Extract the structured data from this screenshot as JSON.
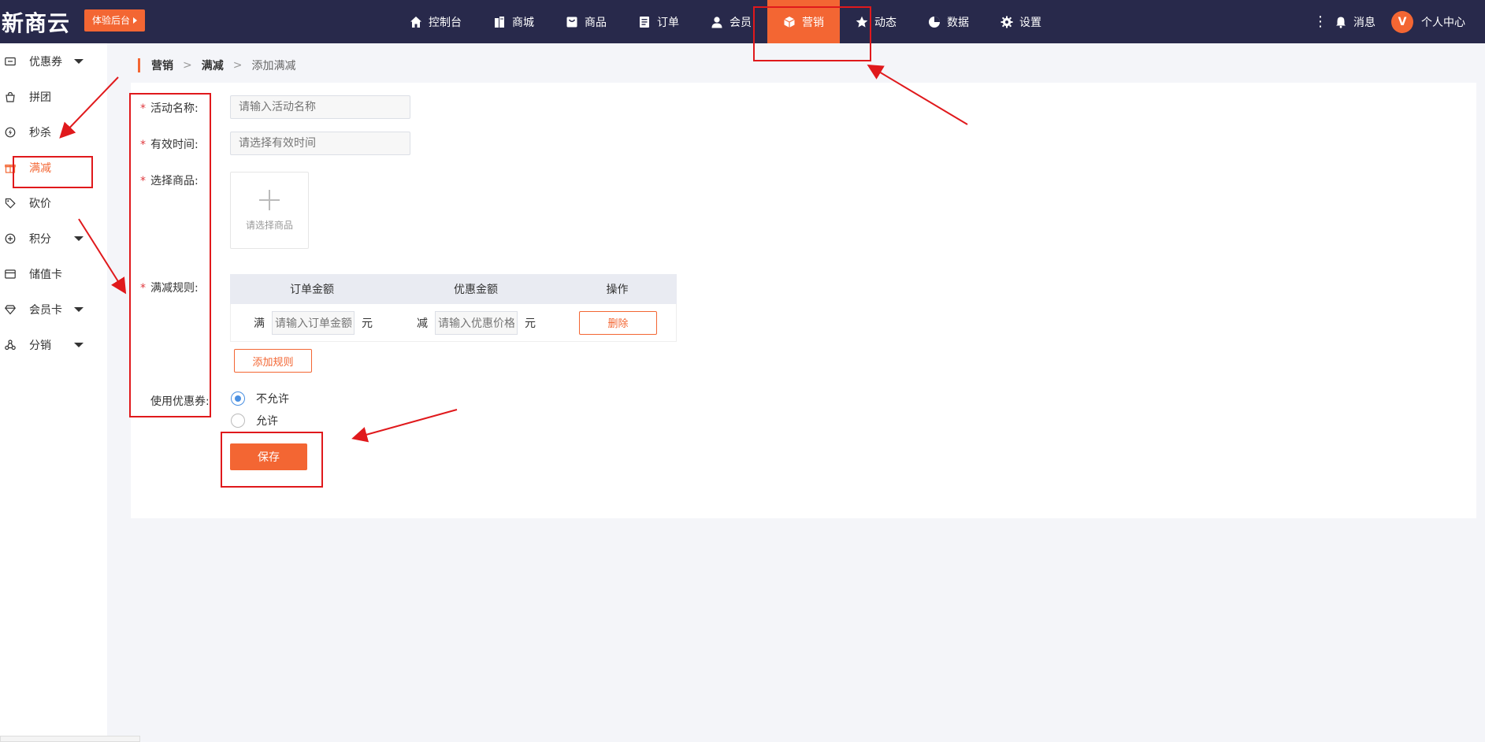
{
  "header": {
    "logo": "新商云",
    "trial_button": "体验后台",
    "nav": [
      {
        "label": "控制台",
        "icon": "home-icon"
      },
      {
        "label": "商城",
        "icon": "store-icon"
      },
      {
        "label": "商品",
        "icon": "goods-icon"
      },
      {
        "label": "订单",
        "icon": "order-icon"
      },
      {
        "label": "会员",
        "icon": "member-icon"
      },
      {
        "label": "营销",
        "icon": "marketing-icon",
        "active": true
      },
      {
        "label": "动态",
        "icon": "star-icon"
      },
      {
        "label": "数据",
        "icon": "pie-chart-icon"
      },
      {
        "label": "设置",
        "icon": "gear-icon"
      }
    ],
    "more": "⋮",
    "message": "消息",
    "user_center": "个人中心",
    "avatar_text": "V"
  },
  "sidebar": {
    "items": [
      {
        "label": "优惠券",
        "icon": "coupon-icon",
        "has_arrow": true
      },
      {
        "label": "拼团",
        "icon": "group-buy-icon",
        "has_arrow": false
      },
      {
        "label": "秒杀",
        "icon": "flash-sale-icon",
        "has_arrow": false
      },
      {
        "label": "满减",
        "icon": "gift-icon",
        "has_arrow": false,
        "active": true
      },
      {
        "label": "砍价",
        "icon": "tag-icon",
        "has_arrow": false
      },
      {
        "label": "积分",
        "icon": "points-icon",
        "has_arrow": true
      },
      {
        "label": "储值卡",
        "icon": "card-icon",
        "has_arrow": false
      },
      {
        "label": "会员卡",
        "icon": "diamond-icon",
        "has_arrow": true
      },
      {
        "label": "分销",
        "icon": "share-icon",
        "has_arrow": true
      }
    ]
  },
  "breadcrumb": [
    "营销",
    "满减",
    "添加满减"
  ],
  "breadcrumb_sep": ">",
  "form": {
    "required_mark": "*",
    "name_label": "活动名称:",
    "name_placeholder": "请输入活动名称",
    "time_label": "有效时间:",
    "time_placeholder": "请选择有效时间",
    "goods_label": "选择商品:",
    "goods_picker_text": "请选择商品",
    "rules_label": "满减规则:",
    "rules_table": {
      "headers": [
        "订单金额",
        "优惠金额",
        "操作"
      ],
      "row": {
        "full_prefix": "满",
        "order_amount_placeholder": "请输入订单金额",
        "unit": "元",
        "reduce_prefix": "减",
        "discount_placeholder": "请输入优惠价格",
        "delete_label": "删除"
      }
    },
    "add_rule_label": "添加规则",
    "coupon_label": "使用优惠券:",
    "coupon_options": [
      {
        "label": "不允许",
        "checked": true
      },
      {
        "label": "允许",
        "checked": false
      }
    ],
    "save_label": "保存"
  },
  "colors": {
    "topbar": "#28294b",
    "accent": "#f36633",
    "annotation": "#e0191c",
    "radio_checked": "#4a90e2"
  }
}
